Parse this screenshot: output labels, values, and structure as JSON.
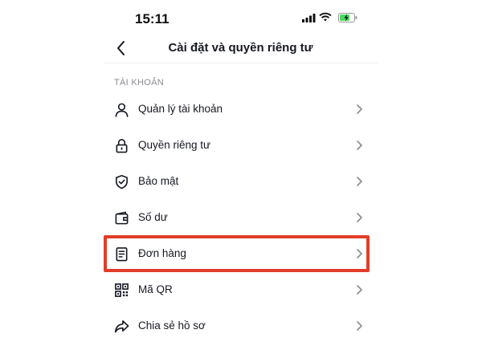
{
  "status_bar": {
    "time": "15:11"
  },
  "header": {
    "title": "Cài đặt và quyền riêng tư",
    "back_icon": "chevron-left-icon"
  },
  "section": {
    "title": "TÀI KHOẢN"
  },
  "items": [
    {
      "label": "Quản lý tài khoản",
      "icon": "person-icon"
    },
    {
      "label": "Quyền riêng tư",
      "icon": "lock-icon"
    },
    {
      "label": "Bảo mật",
      "icon": "shield-icon"
    },
    {
      "label": "Số dư",
      "icon": "wallet-icon"
    },
    {
      "label": "Đơn hàng",
      "icon": "orders-icon",
      "highlighted": true
    },
    {
      "label": "Mã QR",
      "icon": "qr-code-icon"
    },
    {
      "label": "Chia sẻ hồ sơ",
      "icon": "share-icon"
    }
  ],
  "colors": {
    "highlight": "#e23d28",
    "text": "#161823",
    "section_text": "#8a8b91",
    "battery_fill": "#4cd964"
  }
}
